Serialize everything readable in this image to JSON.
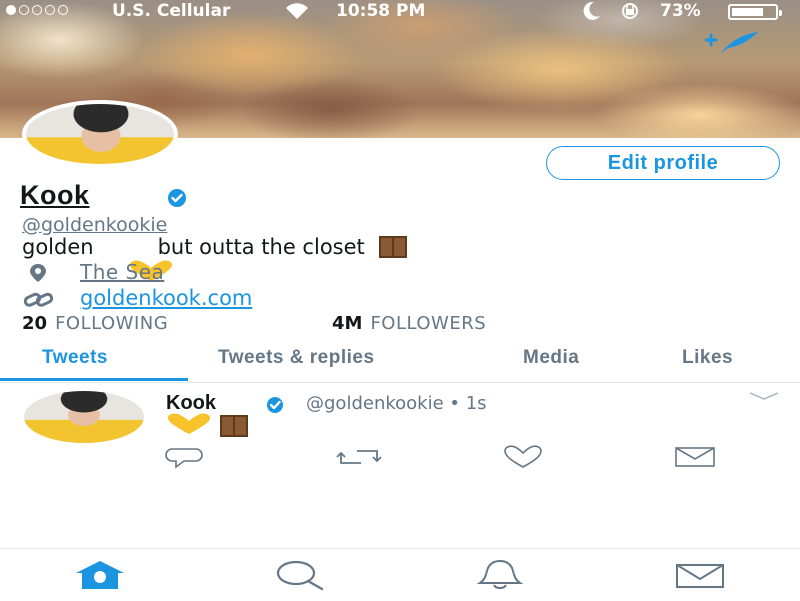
{
  "status_bar": {
    "carrier": "U.S. Cellular",
    "time": "10:58 PM",
    "battery_percent": "73%",
    "battery_level": 0.73,
    "signal_bars_filled": 1,
    "signal_bars_total": 5
  },
  "header": {
    "compose_icon": "compose-quill-icon"
  },
  "profile": {
    "edit_button_label": "Edit profile",
    "name": "Kook",
    "handle": "@goldenkookie",
    "bio_start": "golden",
    "bio_middle": "but outta the closet",
    "location": "The Sea",
    "website": "goldenkook.com",
    "following_count": "20",
    "following_label": "FOLLOWING",
    "followers_count": "4M",
    "followers_label": "FOLLOWERS"
  },
  "tabs": [
    {
      "label": "Tweets",
      "active": true
    },
    {
      "label": "Tweets & replies",
      "active": false
    },
    {
      "label": "Media",
      "active": false
    },
    {
      "label": "Likes",
      "active": false
    }
  ],
  "tweet": {
    "name": "Kook",
    "handle_time": "@goldenkookie • 1s",
    "content_icons": [
      "yellow-heart-icon",
      "door-icon"
    ]
  },
  "bottom_nav": [
    "home-icon",
    "search-icon",
    "notifications-icon",
    "messages-icon"
  ],
  "colors": {
    "accent": "#1b95e0",
    "muted": "#657786",
    "heart": "#f7c22a"
  }
}
